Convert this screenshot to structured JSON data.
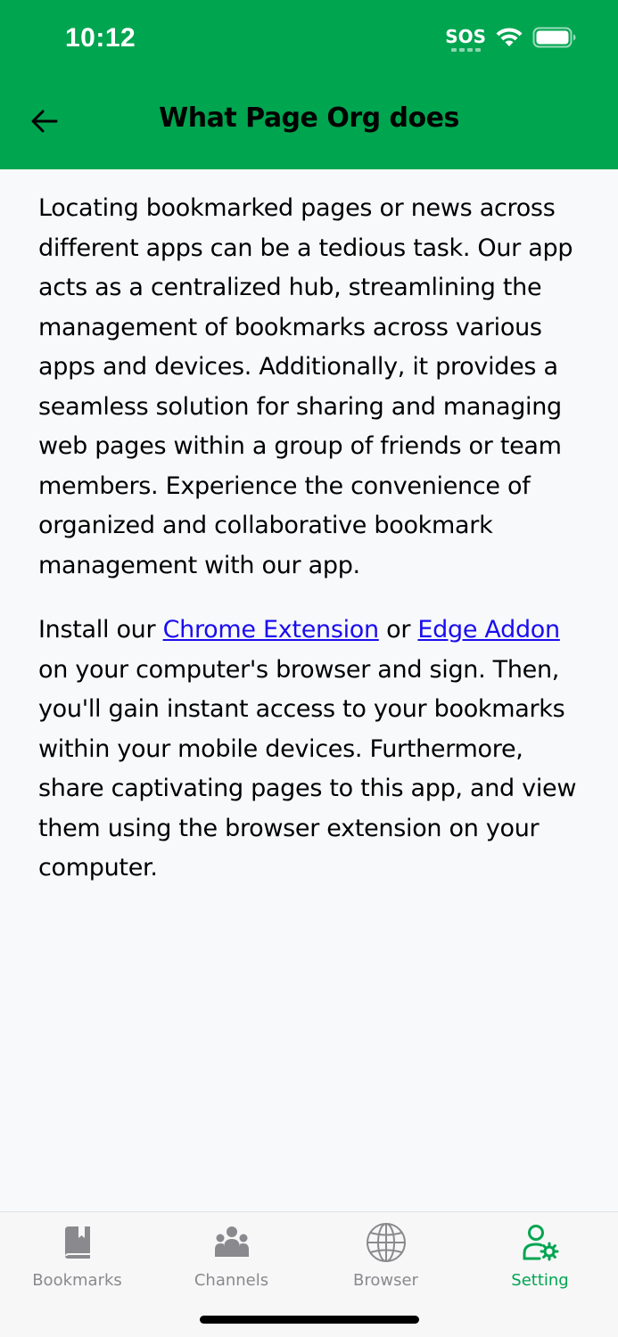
{
  "status_bar": {
    "time": "10:12",
    "sos": "SOS"
  },
  "nav": {
    "title": "What Page Org does"
  },
  "content": {
    "paragraph1": "Locating bookmarked pages or news across different apps can be a tedious task. Our app acts as a centralized hub, streamlining the management of bookmarks across various apps and devices. Additionally, it provides a seamless solution for sharing and managing web pages within a group of friends or team members. Experience the convenience of organized and collaborative bookmark management with our app.",
    "p2_intro": "Install our ",
    "chrome_link": "Chrome Extension",
    "p2_or": " or ",
    "edge_link": "Edge Addon",
    "p2_rest": " on your computer's browser and sign. Then, you'll gain instant access to your bookmarks within your mobile devices. Furthermore, share captivating pages to this app, and view them using the browser extension on your computer."
  },
  "tabs": [
    {
      "label": "Bookmarks",
      "icon": "book-icon",
      "active": false
    },
    {
      "label": "Channels",
      "icon": "people-icon",
      "active": false
    },
    {
      "label": "Browser",
      "icon": "globe-icon",
      "active": false
    },
    {
      "label": "Setting",
      "icon": "user-gear-icon",
      "active": true
    }
  ],
  "colors": {
    "header": "#00a550",
    "link": "#1a0dee",
    "active_tab": "#00a550",
    "inactive_tab": "#8a8a8e"
  }
}
